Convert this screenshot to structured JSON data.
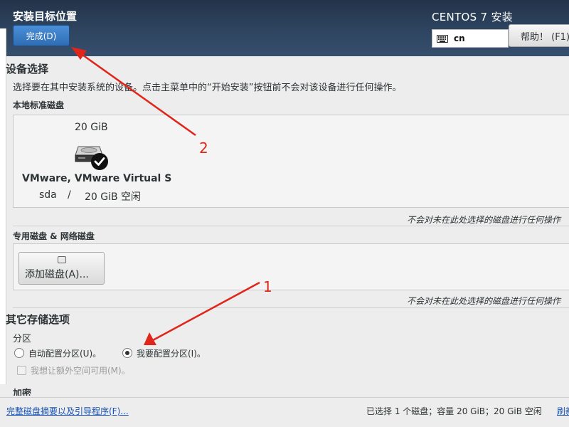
{
  "header": {
    "title": "安装目标位置",
    "done_button": "完成(D)",
    "product": "CENTOS 7 安装",
    "keyboard_layout": "cn",
    "help_button": "帮助！ (F1)"
  },
  "device_selection": {
    "title": "设备选择",
    "description": "选择要在其中安装系统的设备。点击主菜单中的“开始安装”按钮前不会对该设备进行任何操作。",
    "local_disks": {
      "heading": "本地标准磁盘",
      "disks": [
        {
          "size": "20 GiB",
          "name": "VMware, VMware Virtual S",
          "device": "sda",
          "separator": "/",
          "free": "20 GiB 空闲",
          "selected": true
        }
      ],
      "note": "不会对未在此处选择的磁盘进行任何操作"
    },
    "special_disks": {
      "heading": "专用磁盘 & 网络磁盘",
      "add_button": "添加磁盘(A)...",
      "note": "不会对未在此处选择的磁盘进行任何操作"
    }
  },
  "other_storage": {
    "title": "其它存储选项",
    "partition_heading": "分区",
    "auto_partition": "自动配置分区(U)。",
    "manual_partition": "我要配置分区(I)。",
    "selected": "manual",
    "extra_space": "我想让额外空间可用(M)。",
    "encryption_heading": "加密"
  },
  "footer": {
    "summary_link": "完整磁盘摘要以及引导程序(F)...",
    "status": "已选择 1 个磁盘；容量 20 GiB；20 GiB 空闲",
    "refresh_link": "刷新"
  },
  "annotations": {
    "labels": [
      "1",
      "2"
    ],
    "color": "#e0261a"
  }
}
